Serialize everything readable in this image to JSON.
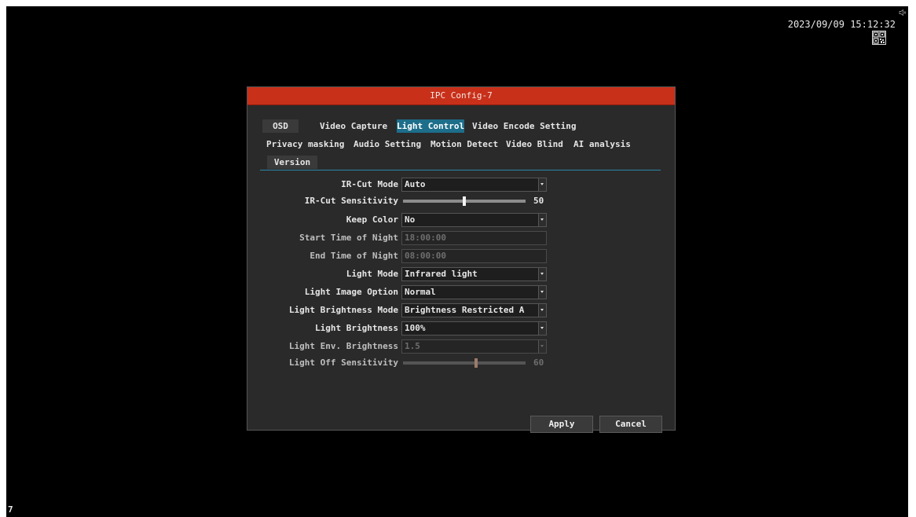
{
  "status": {
    "datetime": "2023/09/09 15:12:32",
    "channel_number": "7"
  },
  "dialog": {
    "title": "IPC Config-7"
  },
  "tabs": [
    {
      "label": "OSD"
    },
    {
      "label": "Video Capture"
    },
    {
      "label": "Light Control",
      "active": true
    },
    {
      "label": "Video Encode Setting"
    },
    {
      "label": "Privacy masking"
    },
    {
      "label": "Audio Setting"
    },
    {
      "label": "Motion Detect"
    },
    {
      "label": "Video Blind"
    },
    {
      "label": "AI analysis"
    },
    {
      "label": "Version"
    }
  ],
  "settings": {
    "ir_cut_mode": {
      "label": "IR-Cut Mode",
      "value": "Auto"
    },
    "ir_cut_sensitivity": {
      "label": "IR-Cut Sensitivity",
      "value": "50",
      "level": 50
    },
    "keep_color": {
      "label": "Keep Color",
      "value": "No"
    },
    "start_time_of_night": {
      "label": "Start Time of Night",
      "value": "18:00:00"
    },
    "end_time_of_night": {
      "label": "End Time of Night",
      "value": "08:00:00"
    },
    "light_mode": {
      "label": "Light Mode",
      "value": "Infrared light"
    },
    "light_image_option": {
      "label": "Light Image Option",
      "value": "Normal"
    },
    "light_brightness_mode": {
      "label": "Light Brightness Mode",
      "value": "Brightness Restricted A"
    },
    "light_brightness": {
      "label": "Light Brightness",
      "value": "100%"
    },
    "light_env_brightness": {
      "label": "Light Env. Brightness",
      "value": "1.5"
    },
    "light_off_sensitivity": {
      "label": "Light Off Sensitivity",
      "value": "60",
      "level": 60
    }
  },
  "buttons": {
    "apply": "Apply",
    "cancel": "Cancel"
  },
  "colors": {
    "titlebar": "#c8301a",
    "active_tab": "#1d6e8a",
    "dialog_bg": "#2a2a2a"
  },
  "icons": {
    "top_right": "speaker-mute-icon",
    "under_clock": "qr-code-icon"
  }
}
